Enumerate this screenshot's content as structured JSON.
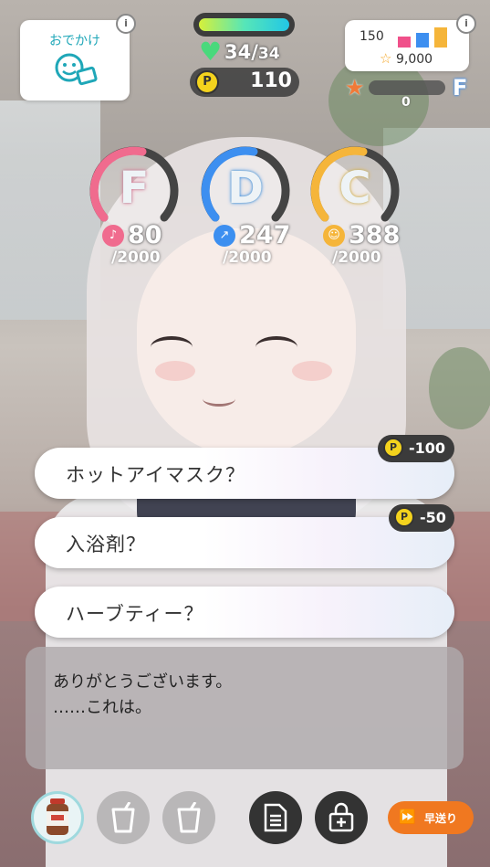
{
  "outing": {
    "label": "おでかけ"
  },
  "hp": {
    "current": "34",
    "separator": "/",
    "max": "34",
    "fill_fraction": 1.0
  },
  "points": {
    "value": "110",
    "coin_symbol": "P"
  },
  "fans": {
    "count": "150",
    "stars": "9,000",
    "rank": "F",
    "progress": "0"
  },
  "stats": [
    {
      "letter": "F",
      "value": "80",
      "max": "/2000",
      "color": "#f06b8e",
      "icon": "microphone-icon"
    },
    {
      "letter": "D",
      "value": "247",
      "max": "/2000",
      "color": "#3d8ff0",
      "icon": "shoe-icon"
    },
    {
      "letter": "C",
      "value": "388",
      "max": "/2000",
      "color": "#f5b53a",
      "icon": "face-icon"
    }
  ],
  "choices": [
    {
      "label": "ホットアイマスク？",
      "cost": "-100"
    },
    {
      "label": "入浴剤？",
      "cost": "-50"
    },
    {
      "label": "ハーブティー？",
      "cost": ""
    }
  ],
  "dialog": {
    "line1": "ありがとうございます。",
    "line2": "……これは。"
  },
  "controls": {
    "fast_forward": "早送り"
  }
}
